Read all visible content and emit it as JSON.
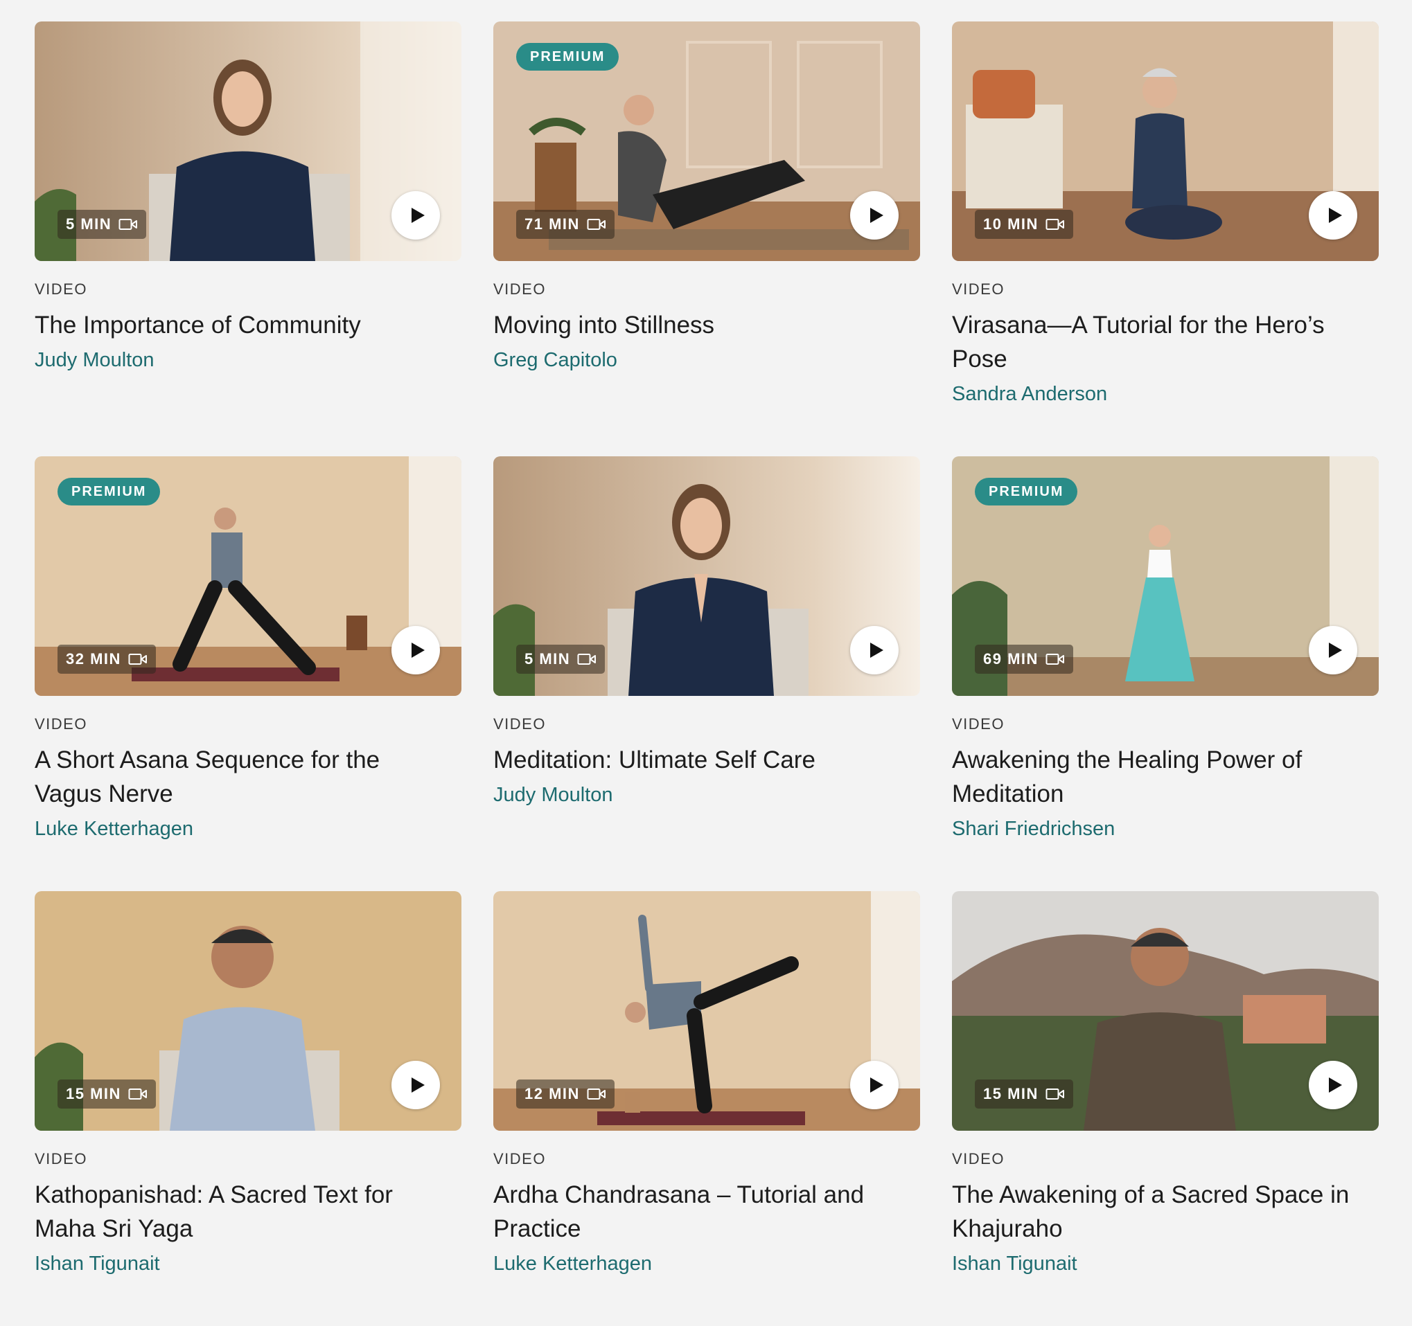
{
  "colors": {
    "background": "#f3f3f3",
    "premium_badge": "#2a8c88",
    "author_link": "#1d6b6f",
    "title_text": "#1c1c1c"
  },
  "cards": [
    {
      "duration": "5 MIN",
      "premium": false,
      "kind": "VIDEO",
      "title": "The Importance of Community",
      "author": "Judy Moulton"
    },
    {
      "duration": "71 MIN",
      "premium": true,
      "badge": "PREMIUM",
      "kind": "VIDEO",
      "title": "Moving into Stillness",
      "author": "Greg Capitolo"
    },
    {
      "duration": "10 MIN",
      "premium": false,
      "kind": "VIDEO",
      "title": "Virasana—A Tutorial for the Hero’s Pose",
      "author": "Sandra Anderson"
    },
    {
      "duration": "32 MIN",
      "premium": true,
      "badge": "PREMIUM",
      "kind": "VIDEO",
      "title": "A Short Asana Sequence for the Vagus Nerve",
      "author": "Luke Ketterhagen"
    },
    {
      "duration": "5 MIN",
      "premium": false,
      "kind": "VIDEO",
      "title": "Meditation: Ultimate Self Care",
      "author": "Judy Moulton"
    },
    {
      "duration": "69 MIN",
      "premium": true,
      "badge": "PREMIUM",
      "kind": "VIDEO",
      "title": "Awakening the Healing Power of Meditation",
      "author": "Shari Friedrichsen"
    },
    {
      "duration": "15 MIN",
      "premium": false,
      "kind": "VIDEO",
      "title": "Kathopanishad: A Sacred Text for Maha Sri Yaga",
      "author": "Ishan Tigunait"
    },
    {
      "duration": "12 MIN",
      "premium": false,
      "kind": "VIDEO",
      "title": "Ardha Chandrasana – Tutorial and Practice",
      "author": "Luke Ketterhagen"
    },
    {
      "duration": "15 MIN",
      "premium": false,
      "kind": "VIDEO",
      "title": "The Awakening of a Sacred Space in Khajuraho",
      "author": "Ishan Tigunait"
    }
  ],
  "icons": {
    "duration": "video-camera-icon",
    "play": "play-icon"
  }
}
